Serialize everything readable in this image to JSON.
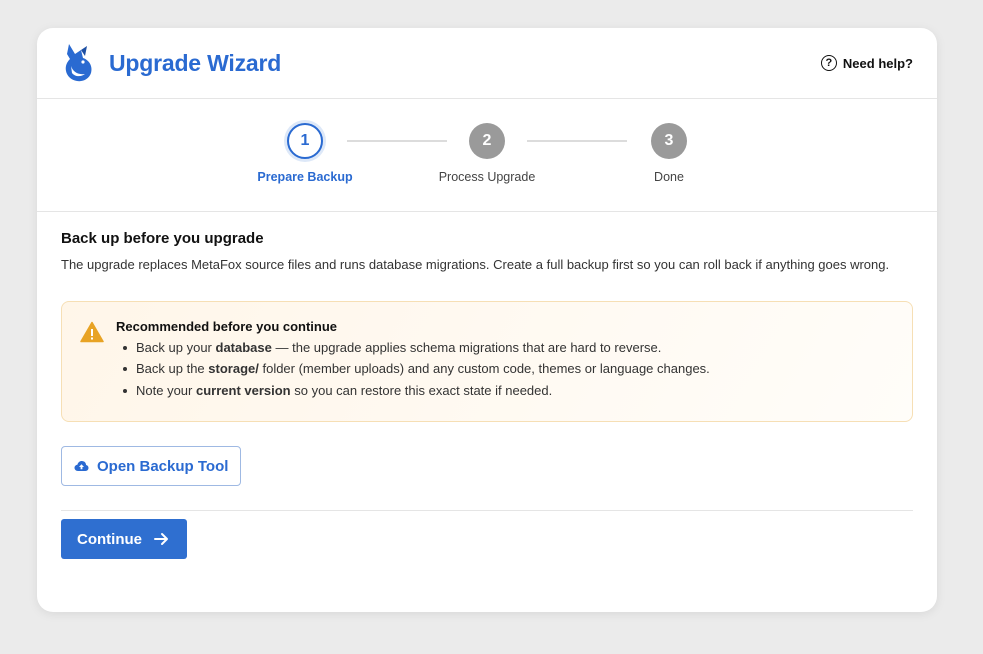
{
  "header": {
    "title": "Upgrade Wizard",
    "help_label": "Need help?",
    "logo_icon": "fox-logo-icon",
    "help_icon": "question-circle-icon"
  },
  "stepper": {
    "steps": [
      {
        "number": "1",
        "label": "Prepare Backup",
        "state": "active"
      },
      {
        "number": "2",
        "label": "Process Upgrade",
        "state": "inactive"
      },
      {
        "number": "3",
        "label": "Done",
        "state": "inactive"
      }
    ]
  },
  "content": {
    "heading": "Back up before you upgrade",
    "description": "The upgrade replaces MetaFox source files and runs database migrations. Create a full backup first so you can roll back if anything goes wrong.",
    "alert": {
      "icon": "warning-triangle-icon",
      "title": "Recommended before you continue",
      "items": [
        {
          "pre": "Back up your ",
          "bold": "database",
          "post": " — the upgrade applies schema migrations that are hard to reverse."
        },
        {
          "pre": "Back up the ",
          "bold": "storage/",
          "post": " folder (member uploads) and any custom code, themes or language changes."
        },
        {
          "pre": "Note your ",
          "bold": "current version",
          "post": " so you can restore this exact state if needed."
        }
      ]
    },
    "backup_button": {
      "label": "Open Backup Tool",
      "icon": "cloud-upload-icon"
    },
    "continue_button": {
      "label": "Continue",
      "icon": "arrow-right-icon"
    }
  },
  "colors": {
    "accent": "#2a6ad1",
    "inactive_step": "#9a9a9a",
    "warning": "#e8a325",
    "alert_border": "#f6dfb5"
  }
}
